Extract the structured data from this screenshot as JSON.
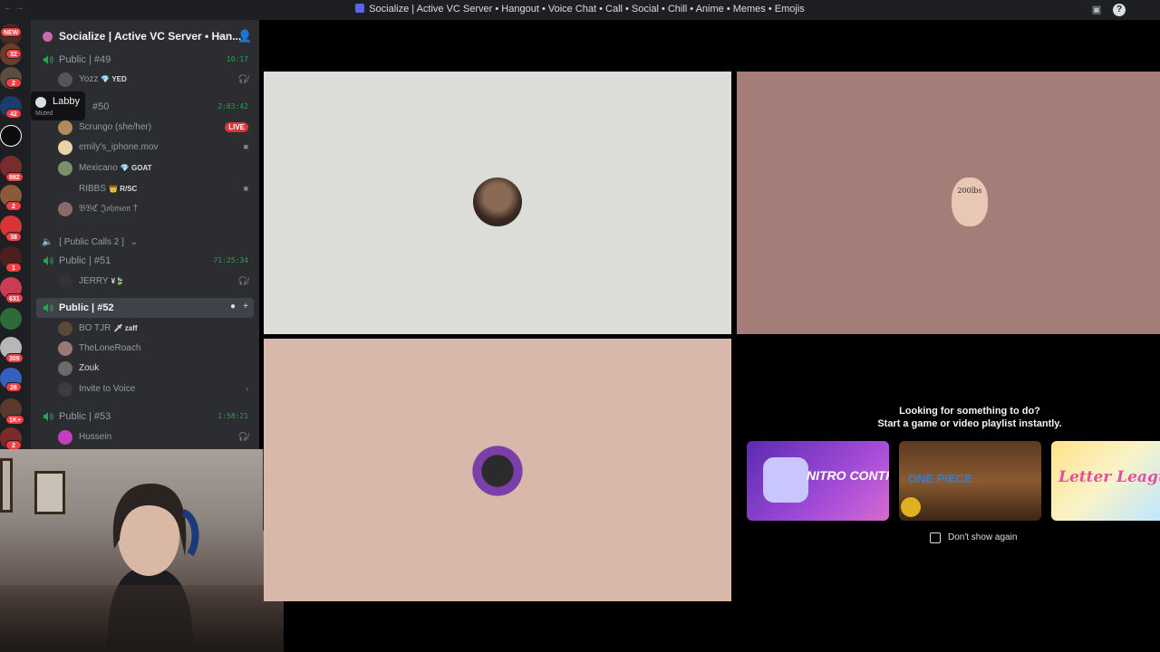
{
  "window": {
    "title": "Socialize | Active VC Server • Hangout • Voice Chat • Call • Social • Chill • Anime • Memes • Emojis"
  },
  "server": {
    "name": "Socialize | Active VC Server • Han..."
  },
  "rail": {
    "badges": [
      "NEW",
      "32",
      "2",
      "42",
      "892",
      "2",
      "38",
      "1",
      "631",
      "309",
      "26",
      "1K+",
      "2"
    ]
  },
  "tooltip": {
    "name": "Labby",
    "status": "Muted"
  },
  "channels": {
    "c49": {
      "name": "Public | #49",
      "timer": "10:17"
    },
    "c50": {
      "name": "#50",
      "timer": "2:03:42"
    },
    "category": "[ Public Calls 2 ]",
    "c51": {
      "name": "Public | #51",
      "timer": "71:25:34"
    },
    "c52": {
      "name": "Public | #52"
    },
    "c53": {
      "name": "Public | #53",
      "timer": "1:58:21"
    }
  },
  "users": {
    "yozz": {
      "name": "Yozz",
      "tag": "💎 YED"
    },
    "scrungo": {
      "name": "Scrungo (she/her)",
      "live": "LIVE"
    },
    "emily": {
      "name": "emily's_iphone.mov"
    },
    "mexicano": {
      "name": "Mexicano",
      "tag": "💎 GOAT"
    },
    "ribbs": {
      "name": "RIBBS",
      "tag": "👑 R/SC"
    },
    "bbc": {
      "name": "𝔅𝔅ℭ 𝔍𝔬𝔥𝔫𝔰𝔬𝔫 †"
    },
    "jerry": {
      "name": "JERRY",
      "tag": "¥🍃"
    },
    "bo": {
      "name": "BO TJR",
      "tag": "🗡 zaff"
    },
    "loneroach": {
      "name": "TheLoneRoach"
    },
    "zouk": {
      "name": "Zouk"
    },
    "invite": {
      "name": "Invite to Voice"
    },
    "hussein": {
      "name": "Hussein"
    }
  },
  "activity": {
    "line1": "Looking for something to do?",
    "line2": "Start a game or video playlist instantly.",
    "cards": [
      {
        "name": "NITRO CONTROL"
      },
      {
        "name": "ONE PIECE"
      },
      {
        "name": "Letter League"
      }
    ],
    "dont_show": "Don't show again"
  },
  "tiles": {
    "avatar_2_text": "200lbs"
  },
  "colors": {
    "tile1": "#dcdcd8",
    "tile2": "#a47c78",
    "tile3": "#d8b8aa",
    "online_green": "#23a559",
    "live_red": "#da373c"
  }
}
